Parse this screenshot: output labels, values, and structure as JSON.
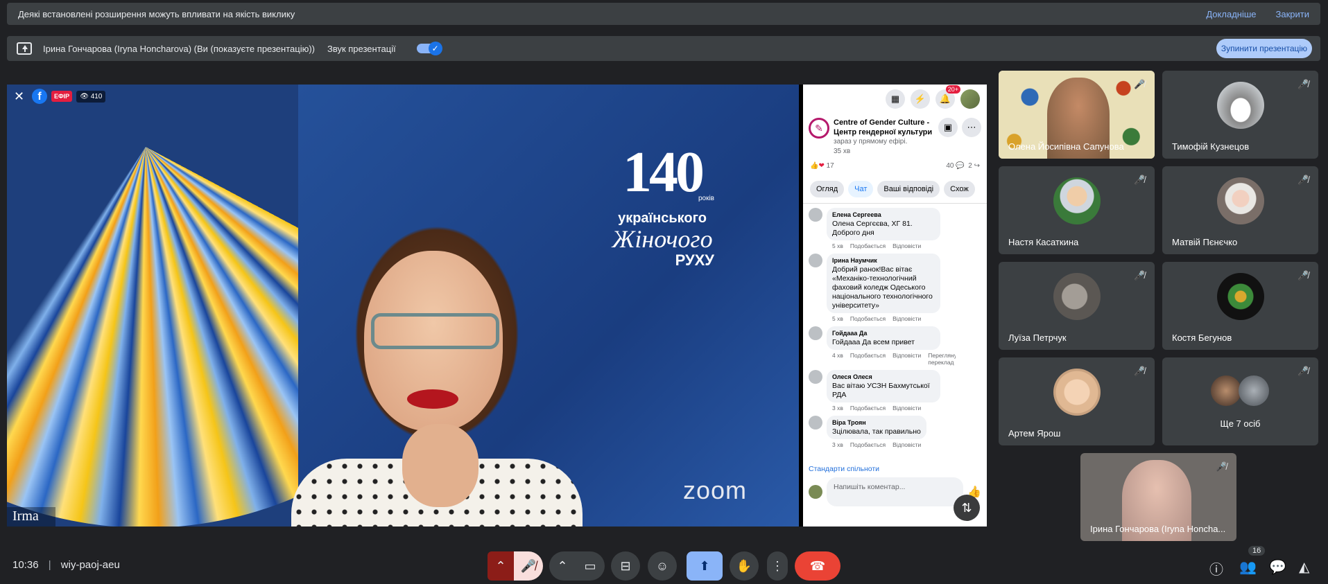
{
  "warning_bar": {
    "message": "Деякі встановлені розширення можуть впливати на якість виклику",
    "learn_more": "Докладніше",
    "close": "Закрити"
  },
  "presenting_bar": {
    "presenter": "Ірина Гончарова (Iryna Honcharova) (Ви (показуєте презентацію))",
    "audio_label": "Звук презентації",
    "audio_enabled": true,
    "stop_button": "Зупинити презентацію"
  },
  "video": {
    "live_badge": "ЕФІР",
    "views": "410",
    "logo_number": "140",
    "logo_years": "років",
    "logo_line1": "українського",
    "logo_line2": "Жіночого",
    "logo_line3": "РУХУ",
    "watermark": "zoom",
    "name_tag": "Irma"
  },
  "facebook": {
    "notifications": "20+",
    "page_name": "Centre of Gender Culture - Центр гендерної культури",
    "live_status": "зараз у прямому ефірі.",
    "time_ago": "35 хв",
    "reactions": "17",
    "comments_count": "40",
    "shares": "2",
    "tabs": [
      "Огляд",
      "Чат",
      "Ваші відповіді",
      "Схож"
    ],
    "comments": [
      {
        "author": "Елена Сергеева",
        "text": "Олена Сергєєва, ХГ 81. Доброго дня",
        "time": "5 хв",
        "like": "Подобається",
        "reply": "Відповісти"
      },
      {
        "author": "Ірина Наумчик",
        "text": "Добрий ранок!Вас вітає «Механіко-технологічний фаховий коледж Одеського національного технологічного університету»",
        "time": "5 хв",
        "like": "Подобається",
        "reply": "Відповісти"
      },
      {
        "author": "Гойдааа Да",
        "text": "Гойдааа Да всем привет",
        "time": "4 хв",
        "like": "Подобається",
        "reply": "Відповісти",
        "extra": "Переглянути переклад"
      },
      {
        "author": "Олеся Олеся",
        "text": "Вас вітаю УСЗН Бахмутської РДА",
        "time": "3 хв",
        "like": "Подобається",
        "reply": "Відповісти"
      },
      {
        "author": "Віра Троян",
        "text": "Зцілювала, так правильно",
        "time": "3 хв",
        "like": "Подобається",
        "reply": "Відповісти"
      }
    ],
    "community_standards": "Стандарти спільноти",
    "comment_placeholder": "Напишіть коментар..."
  },
  "participants": [
    {
      "name": "Олена Йосипівна Сапунова",
      "muted": true
    },
    {
      "name": "Тимофій Кузнецов",
      "muted": true
    },
    {
      "name": "Настя Касаткина",
      "muted": true
    },
    {
      "name": "Матвій Пєнєчко",
      "muted": true
    },
    {
      "name": "Луїза Петрчук",
      "muted": true
    },
    {
      "name": "Костя Бегунов",
      "muted": true
    },
    {
      "name": "Артем Ярош",
      "muted": true
    },
    {
      "name": "Ще 7 осіб",
      "muted": true
    }
  ],
  "self_tile": {
    "name": "Ірина Гончарова (Iryna Honcha...",
    "muted": true
  },
  "bottom_bar": {
    "time": "10:36",
    "meeting_code": "wiy-paoj-aeu",
    "participants_count": "16"
  },
  "colors": {
    "background": "#202124",
    "surface": "#3c4043",
    "accent": "#8ab4f8",
    "end_call": "#ea4335",
    "mic_off": "#f9dedc"
  }
}
